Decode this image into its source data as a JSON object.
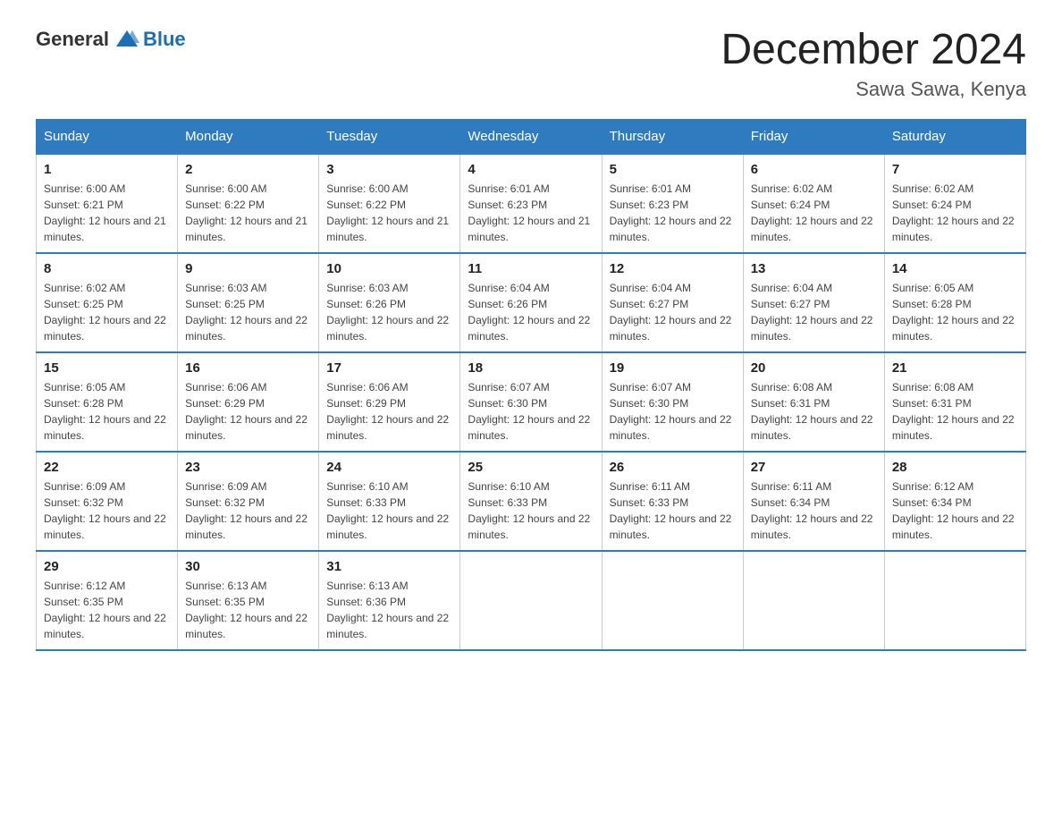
{
  "logo": {
    "general": "General",
    "blue": "Blue"
  },
  "title": "December 2024",
  "subtitle": "Sawa Sawa, Kenya",
  "days_of_week": [
    "Sunday",
    "Monday",
    "Tuesday",
    "Wednesday",
    "Thursday",
    "Friday",
    "Saturday"
  ],
  "weeks": [
    [
      {
        "day": "1",
        "sunrise": "6:00 AM",
        "sunset": "6:21 PM",
        "daylight": "12 hours and 21 minutes."
      },
      {
        "day": "2",
        "sunrise": "6:00 AM",
        "sunset": "6:22 PM",
        "daylight": "12 hours and 21 minutes."
      },
      {
        "day": "3",
        "sunrise": "6:00 AM",
        "sunset": "6:22 PM",
        "daylight": "12 hours and 21 minutes."
      },
      {
        "day": "4",
        "sunrise": "6:01 AM",
        "sunset": "6:23 PM",
        "daylight": "12 hours and 21 minutes."
      },
      {
        "day": "5",
        "sunrise": "6:01 AM",
        "sunset": "6:23 PM",
        "daylight": "12 hours and 22 minutes."
      },
      {
        "day": "6",
        "sunrise": "6:02 AM",
        "sunset": "6:24 PM",
        "daylight": "12 hours and 22 minutes."
      },
      {
        "day": "7",
        "sunrise": "6:02 AM",
        "sunset": "6:24 PM",
        "daylight": "12 hours and 22 minutes."
      }
    ],
    [
      {
        "day": "8",
        "sunrise": "6:02 AM",
        "sunset": "6:25 PM",
        "daylight": "12 hours and 22 minutes."
      },
      {
        "day": "9",
        "sunrise": "6:03 AM",
        "sunset": "6:25 PM",
        "daylight": "12 hours and 22 minutes."
      },
      {
        "day": "10",
        "sunrise": "6:03 AM",
        "sunset": "6:26 PM",
        "daylight": "12 hours and 22 minutes."
      },
      {
        "day": "11",
        "sunrise": "6:04 AM",
        "sunset": "6:26 PM",
        "daylight": "12 hours and 22 minutes."
      },
      {
        "day": "12",
        "sunrise": "6:04 AM",
        "sunset": "6:27 PM",
        "daylight": "12 hours and 22 minutes."
      },
      {
        "day": "13",
        "sunrise": "6:04 AM",
        "sunset": "6:27 PM",
        "daylight": "12 hours and 22 minutes."
      },
      {
        "day": "14",
        "sunrise": "6:05 AM",
        "sunset": "6:28 PM",
        "daylight": "12 hours and 22 minutes."
      }
    ],
    [
      {
        "day": "15",
        "sunrise": "6:05 AM",
        "sunset": "6:28 PM",
        "daylight": "12 hours and 22 minutes."
      },
      {
        "day": "16",
        "sunrise": "6:06 AM",
        "sunset": "6:29 PM",
        "daylight": "12 hours and 22 minutes."
      },
      {
        "day": "17",
        "sunrise": "6:06 AM",
        "sunset": "6:29 PM",
        "daylight": "12 hours and 22 minutes."
      },
      {
        "day": "18",
        "sunrise": "6:07 AM",
        "sunset": "6:30 PM",
        "daylight": "12 hours and 22 minutes."
      },
      {
        "day": "19",
        "sunrise": "6:07 AM",
        "sunset": "6:30 PM",
        "daylight": "12 hours and 22 minutes."
      },
      {
        "day": "20",
        "sunrise": "6:08 AM",
        "sunset": "6:31 PM",
        "daylight": "12 hours and 22 minutes."
      },
      {
        "day": "21",
        "sunrise": "6:08 AM",
        "sunset": "6:31 PM",
        "daylight": "12 hours and 22 minutes."
      }
    ],
    [
      {
        "day": "22",
        "sunrise": "6:09 AM",
        "sunset": "6:32 PM",
        "daylight": "12 hours and 22 minutes."
      },
      {
        "day": "23",
        "sunrise": "6:09 AM",
        "sunset": "6:32 PM",
        "daylight": "12 hours and 22 minutes."
      },
      {
        "day": "24",
        "sunrise": "6:10 AM",
        "sunset": "6:33 PM",
        "daylight": "12 hours and 22 minutes."
      },
      {
        "day": "25",
        "sunrise": "6:10 AM",
        "sunset": "6:33 PM",
        "daylight": "12 hours and 22 minutes."
      },
      {
        "day": "26",
        "sunrise": "6:11 AM",
        "sunset": "6:33 PM",
        "daylight": "12 hours and 22 minutes."
      },
      {
        "day": "27",
        "sunrise": "6:11 AM",
        "sunset": "6:34 PM",
        "daylight": "12 hours and 22 minutes."
      },
      {
        "day": "28",
        "sunrise": "6:12 AM",
        "sunset": "6:34 PM",
        "daylight": "12 hours and 22 minutes."
      }
    ],
    [
      {
        "day": "29",
        "sunrise": "6:12 AM",
        "sunset": "6:35 PM",
        "daylight": "12 hours and 22 minutes."
      },
      {
        "day": "30",
        "sunrise": "6:13 AM",
        "sunset": "6:35 PM",
        "daylight": "12 hours and 22 minutes."
      },
      {
        "day": "31",
        "sunrise": "6:13 AM",
        "sunset": "6:36 PM",
        "daylight": "12 hours and 22 minutes."
      },
      null,
      null,
      null,
      null
    ]
  ]
}
